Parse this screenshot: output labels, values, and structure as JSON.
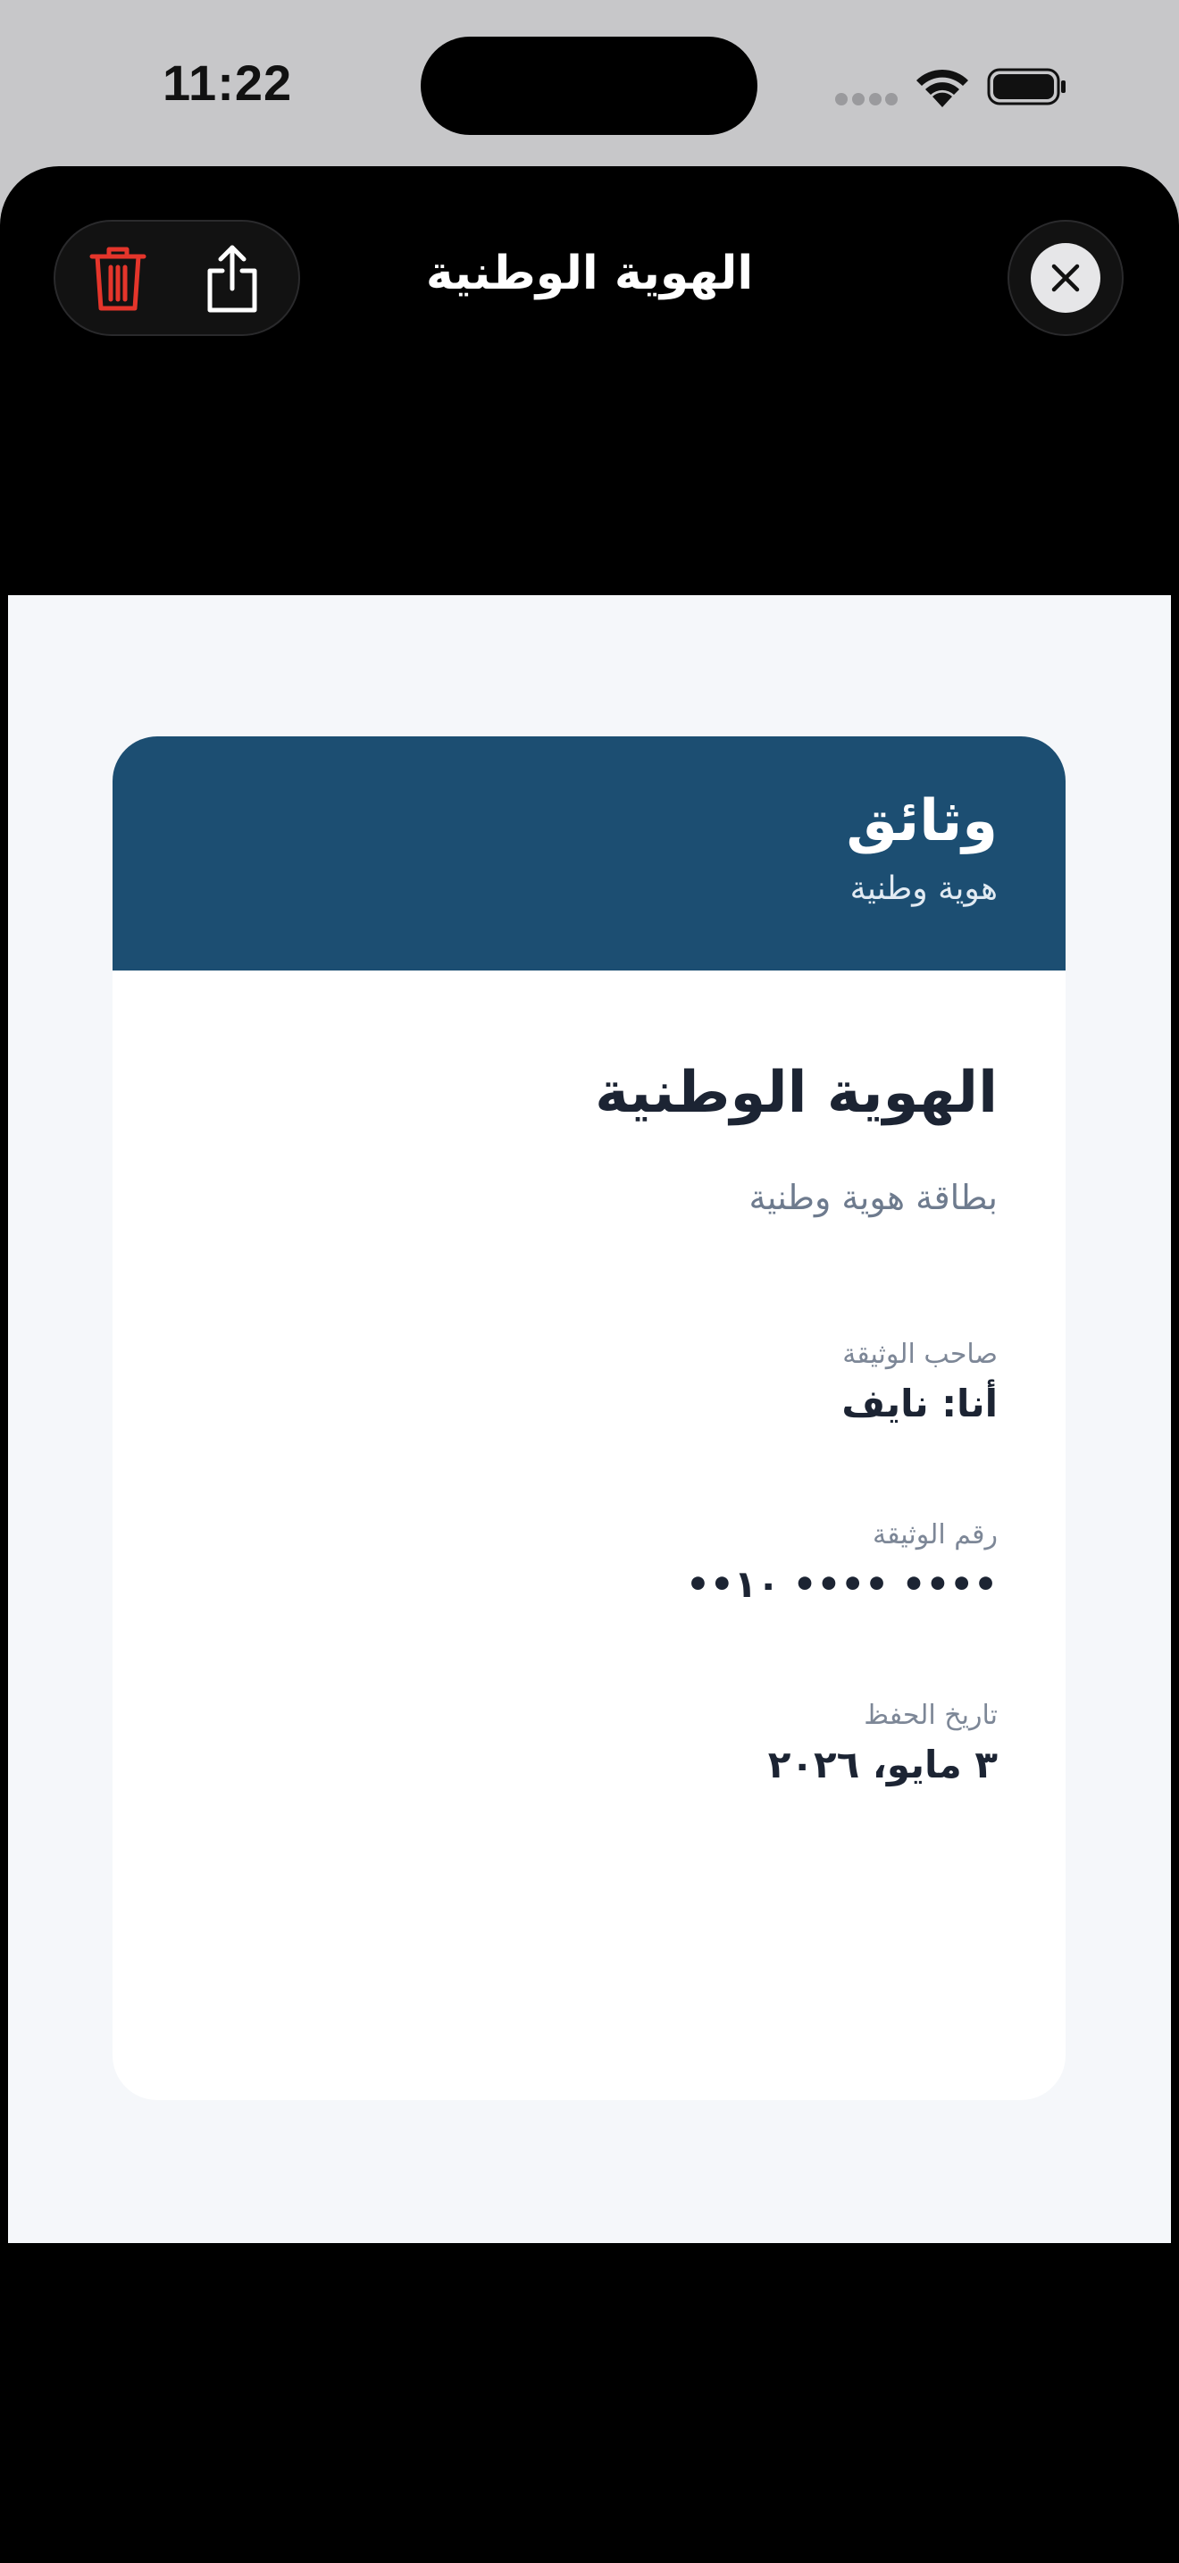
{
  "status_bar": {
    "time": "11:22"
  },
  "toolbar": {
    "title": "الهوية الوطنية",
    "delete_icon": "trash-icon",
    "share_icon": "share-icon",
    "close_icon": "close-icon",
    "delete_color": "#e5352b"
  },
  "document": {
    "brand": "وثائق",
    "brand_subtitle": "هوية وطنية",
    "title": "الهوية الوطنية",
    "subtitle": "بطاقة هوية وطنية",
    "fields": [
      {
        "label": "صاحب الوثيقة",
        "value": "أنا: نايف"
      },
      {
        "label": "رقم الوثيقة",
        "value": "••١٠ •••• ••••"
      },
      {
        "label": "تاريخ الحفظ",
        "value": "٣ مايو، ٢٠٢٦"
      }
    ],
    "header_color": "#1c4e72"
  }
}
